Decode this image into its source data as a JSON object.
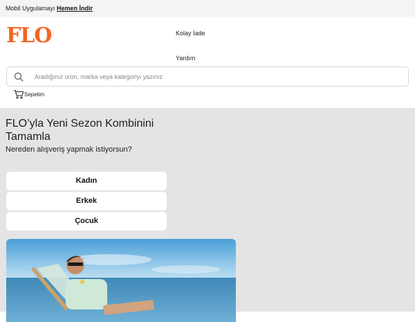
{
  "topbar": {
    "text": "Mobil Uygulamayı",
    "link": "Hemen İndir"
  },
  "header": {
    "logo": "FLO",
    "nav": [
      "Kolay İade",
      "Yardım"
    ],
    "search_placeholder": "Aradığınız ürün, marka veya kategoriyi yazınız",
    "cart_label": "Sepetim"
  },
  "main": {
    "title": "FLO’yla Yeni Sezon Kombinini Tamamla",
    "subtitle": "Nereden alışveriş yapmak istiyorsun?",
    "categories": [
      "Kadın",
      "Erkek",
      "Çocuk"
    ]
  },
  "colors": {
    "brand": "#f26522",
    "background": "#e4e4e4"
  }
}
